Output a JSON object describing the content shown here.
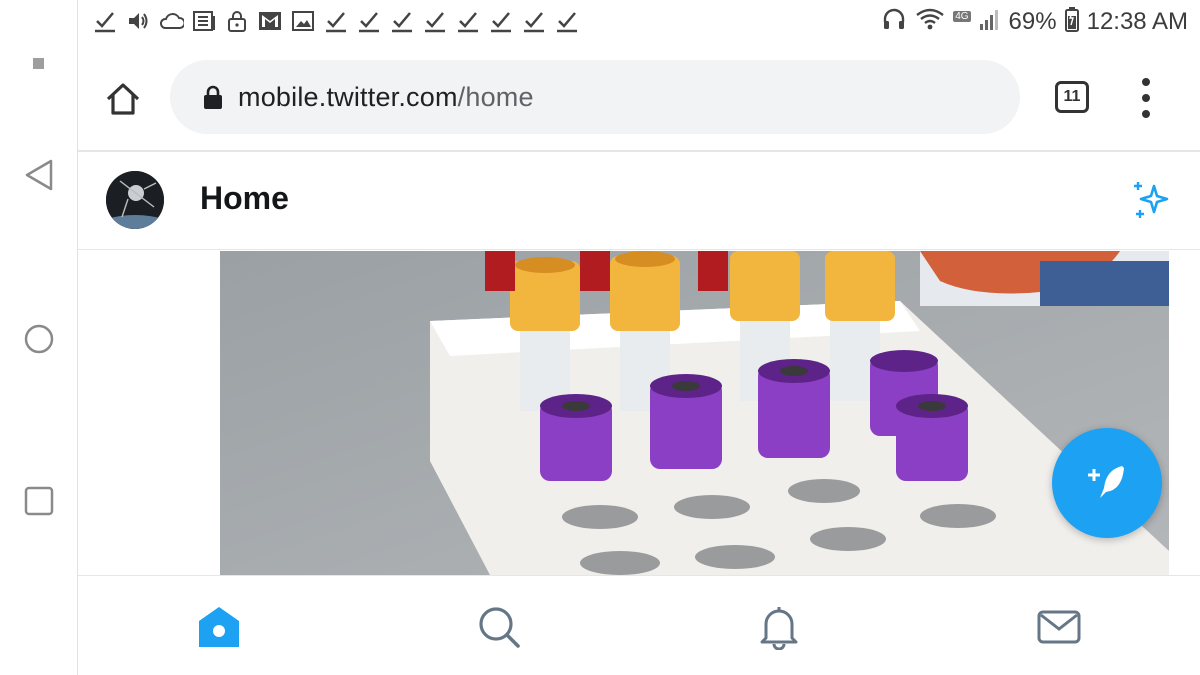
{
  "status_bar": {
    "battery": "69%",
    "time": "12:38 AM",
    "network_badge": "4G",
    "left_icons": [
      "check-icon",
      "volume-icon",
      "cloud-icon",
      "news-icon",
      "lock-icon",
      "gmail-icon",
      "image-icon",
      "check-icon",
      "check-icon",
      "check-icon",
      "check-icon",
      "check-icon",
      "check-icon",
      "check-icon",
      "check-icon"
    ],
    "right_icons": [
      "headphones-icon",
      "wifi-icon",
      "signal-icon",
      "battery-icon"
    ]
  },
  "android_nav": [
    "recents-dot-icon",
    "back-icon",
    "home-circle-icon",
    "overview-square-icon"
  ],
  "browser": {
    "url_host": "mobile.twitter.com",
    "url_path": "/home",
    "tab_count": "11"
  },
  "twitter": {
    "header_title": "Home",
    "accent_color": "#1da1f2",
    "bottom_nav": [
      "home-icon",
      "search-icon",
      "notifications-icon",
      "messages-icon"
    ],
    "media_description_icons": [
      "video-thumbnail"
    ]
  }
}
